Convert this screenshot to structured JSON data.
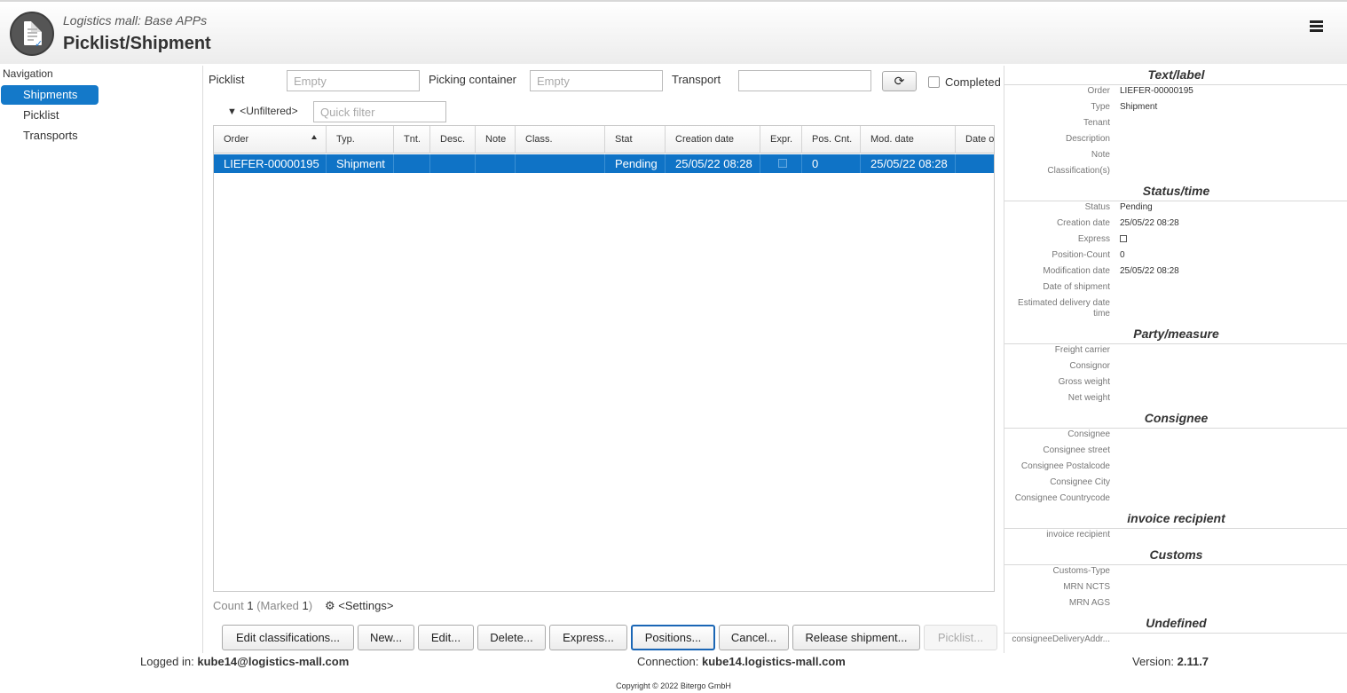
{
  "header": {
    "subtitle": "Logistics mall: Base APPs",
    "title": "Picklist/Shipment"
  },
  "navigation": {
    "title": "Navigation",
    "items": [
      {
        "label": "Shipments",
        "active": true
      },
      {
        "label": "Picklist",
        "active": false
      },
      {
        "label": "Transports",
        "active": false
      }
    ]
  },
  "filters": {
    "picklist_label": "Picklist",
    "picklist_placeholder": "Empty",
    "container_label": "Picking container",
    "container_placeholder": "Empty",
    "transport_label": "Transport",
    "transport_value": "",
    "refresh_glyph": "⟳",
    "completed_label": "Completed",
    "filter_label": "<Unfiltered>",
    "quick_filter_placeholder": "Quick filter"
  },
  "table": {
    "columns": [
      "Order",
      "Typ.",
      "Tnt.",
      "Desc.",
      "Note",
      "Class.",
      "Stat",
      "Creation date",
      "Expr.",
      "Pos. Cnt.",
      "Mod. date",
      "Date of"
    ],
    "rows": [
      {
        "order": "LIEFER-00000195",
        "type": "Shipment",
        "tenant": "",
        "desc": "",
        "note": "",
        "class": "",
        "status": "Pending",
        "creation_date": "25/05/22 08:28",
        "express": false,
        "pos_count": "0",
        "mod_date": "25/05/22 08:28",
        "date_of": ""
      }
    ]
  },
  "grid_footer": {
    "count_label": "Count",
    "count_value": "1",
    "marked_prefix": "(Marked",
    "marked_value": "1",
    "marked_suffix": ")",
    "settings_label": "<Settings>"
  },
  "buttons": [
    "Edit classifications...",
    "New...",
    "Edit...",
    "Delete...",
    "Express...",
    "Positions...",
    "Cancel...",
    "Release shipment...",
    "Picklist..."
  ],
  "details": {
    "text_label": {
      "title": "Text/label",
      "fields": [
        {
          "label": "Order",
          "value": "LIEFER-00000195"
        },
        {
          "label": "Type",
          "value": "Shipment"
        },
        {
          "label": "Tenant",
          "value": ""
        },
        {
          "label": "Description",
          "value": ""
        },
        {
          "label": "Note",
          "value": ""
        },
        {
          "label": "Classification(s)",
          "value": ""
        }
      ]
    },
    "status_time": {
      "title": "Status/time",
      "fields": [
        {
          "label": "Status",
          "value": "Pending"
        },
        {
          "label": "Creation date",
          "value": "25/05/22 08:28"
        },
        {
          "label": "Express",
          "value": ""
        },
        {
          "label": "Position-Count",
          "value": "0"
        },
        {
          "label": "Modification date",
          "value": "25/05/22 08:28"
        },
        {
          "label": "Date of shipment",
          "value": ""
        },
        {
          "label": "Estimated delivery date time",
          "value": ""
        }
      ]
    },
    "party_measure": {
      "title": "Party/measure",
      "fields": [
        {
          "label": "Freight carrier",
          "value": ""
        },
        {
          "label": "Consignor",
          "value": ""
        },
        {
          "label": "Gross weight",
          "value": ""
        },
        {
          "label": "Net weight",
          "value": ""
        }
      ]
    },
    "consignee": {
      "title": "Consignee",
      "fields": [
        {
          "label": "Consignee",
          "value": ""
        },
        {
          "label": "Consignee street",
          "value": ""
        },
        {
          "label": "Consignee Postalcode",
          "value": ""
        },
        {
          "label": "Consignee City",
          "value": ""
        },
        {
          "label": "Consignee Countrycode",
          "value": ""
        }
      ]
    },
    "invoice": {
      "title": "invoice recipient",
      "fields": [
        {
          "label": "invoice recipient",
          "value": ""
        }
      ]
    },
    "customs": {
      "title": "Customs",
      "fields": [
        {
          "label": "Customs-Type",
          "value": ""
        },
        {
          "label": "MRN NCTS",
          "value": ""
        },
        {
          "label": "MRN AGS",
          "value": ""
        }
      ]
    },
    "undefined": {
      "title": "Undefined",
      "fields": [
        {
          "label": "consigneeDeliveryAddr...",
          "value": ""
        }
      ]
    }
  },
  "status_bar": {
    "logged_label": "Logged in:",
    "logged_value": "kube14@logistics-mall.com",
    "connection_label": "Connection:",
    "connection_value": "kube14.logistics-mall.com",
    "version_label": "Version:",
    "version_value": "2.11.7",
    "copyright": "Copyright © 2022 Bitergo GmbH"
  }
}
